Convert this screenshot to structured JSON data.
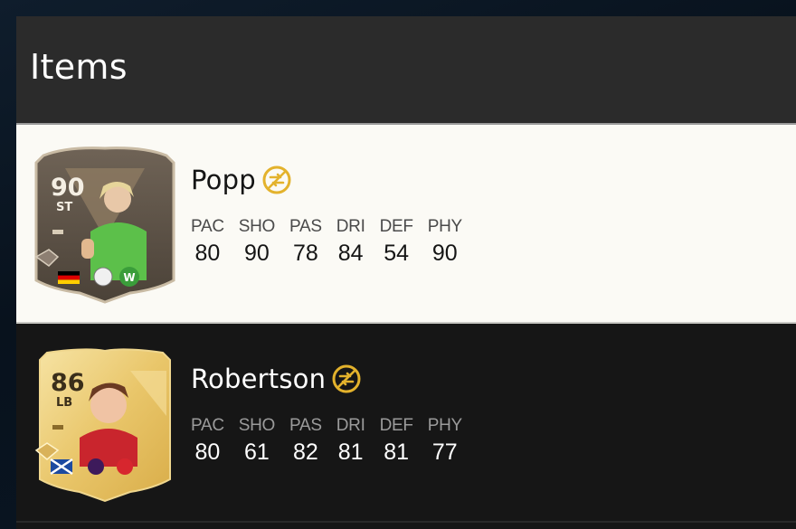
{
  "header": {
    "title": "Items"
  },
  "items": [
    {
      "name": "Popp",
      "rating": "90",
      "position": "ST",
      "untradeable_icon": "untradeable-icon",
      "stats": [
        {
          "label": "PAC",
          "value": "80"
        },
        {
          "label": "SHO",
          "value": "90"
        },
        {
          "label": "PAS",
          "value": "78"
        },
        {
          "label": "DRI",
          "value": "84"
        },
        {
          "label": "DEF",
          "value": "54"
        },
        {
          "label": "PHY",
          "value": "90"
        }
      ]
    },
    {
      "name": "Robertson",
      "rating": "86",
      "position": "LB",
      "untradeable_icon": "untradeable-icon",
      "stats": [
        {
          "label": "PAC",
          "value": "80"
        },
        {
          "label": "SHO",
          "value": "61"
        },
        {
          "label": "PAS",
          "value": "82"
        },
        {
          "label": "DRI",
          "value": "81"
        },
        {
          "label": "DEF",
          "value": "81"
        },
        {
          "label": "PHY",
          "value": "77"
        }
      ]
    }
  ],
  "colors": {
    "accent_gold": "#e3b22c",
    "card_gold": "#e9c66a",
    "card_dark": "#5b4f42"
  }
}
